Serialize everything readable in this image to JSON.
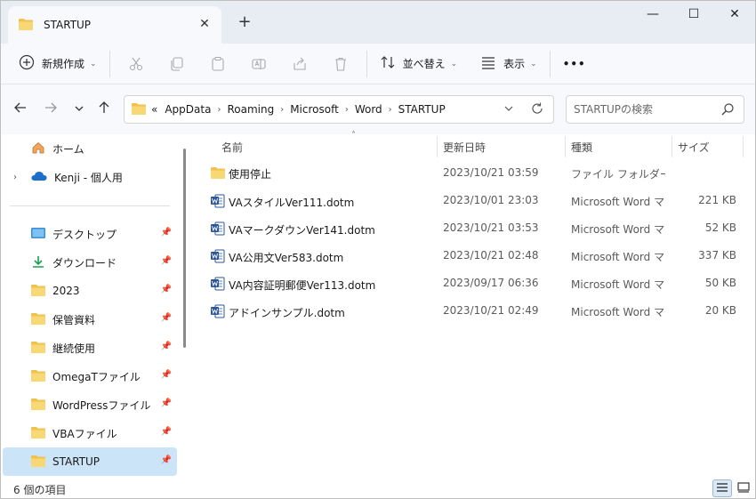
{
  "window": {
    "tab_title": "STARTUP",
    "tab_close": "✕",
    "new_tab": "+",
    "minimize": "—",
    "maximize": "☐",
    "close": "✕"
  },
  "commandbar": {
    "new_label": "新規作成",
    "sort_label": "並べ替え",
    "view_label": "表示",
    "more_label": "•••"
  },
  "address": {
    "overflow": "«",
    "crumbs": [
      "AppData",
      "Roaming",
      "Microsoft",
      "Word",
      "STARTUP"
    ],
    "separator": "›",
    "search_placeholder": "STARTUPの検索"
  },
  "sidebar": {
    "home": "ホーム",
    "cloud": "Kenji - 個人用",
    "items": [
      {
        "label": "デスクトップ",
        "icon": "desktop-icon"
      },
      {
        "label": "ダウンロード",
        "icon": "download-icon"
      },
      {
        "label": "2023",
        "icon": "folder-icon"
      },
      {
        "label": "保管資料",
        "icon": "folder-icon"
      },
      {
        "label": "継続使用",
        "icon": "folder-icon"
      },
      {
        "label": "OmegaTファイル",
        "icon": "folder-icon"
      },
      {
        "label": "WordPressファイル",
        "icon": "folder-icon"
      },
      {
        "label": "VBAファイル",
        "icon": "folder-icon"
      },
      {
        "label": "STARTUP",
        "icon": "folder-icon"
      }
    ]
  },
  "columns": {
    "name": "名前",
    "date": "更新日時",
    "type": "種類",
    "size": "サイズ"
  },
  "files": [
    {
      "name": "使用停止",
      "date": "2023/10/21 03:59",
      "type": "ファイル フォルダー",
      "size": "",
      "kind": "folder"
    },
    {
      "name": "VAスタイルVer111.dotm",
      "date": "2023/10/01 23:03",
      "type": "Microsoft Word マ...",
      "size": "221 KB",
      "kind": "word"
    },
    {
      "name": "VAマークダウンVer141.dotm",
      "date": "2023/10/21 03:53",
      "type": "Microsoft Word マ...",
      "size": "52 KB",
      "kind": "word"
    },
    {
      "name": "VA公用文Ver583.dotm",
      "date": "2023/10/21 02:48",
      "type": "Microsoft Word マ...",
      "size": "337 KB",
      "kind": "word"
    },
    {
      "name": "VA内容証明郵便Ver113.dotm",
      "date": "2023/09/17 06:36",
      "type": "Microsoft Word マ...",
      "size": "50 KB",
      "kind": "word"
    },
    {
      "name": "アドインサンプル.dotm",
      "date": "2023/10/21 02:49",
      "type": "Microsoft Word マ...",
      "size": "20 KB",
      "kind": "word"
    }
  ],
  "status": {
    "item_count": "6 個の項目"
  },
  "colors": {
    "folder": "#f2c14e",
    "word": "#2b579a",
    "selected": "#cce4f7",
    "accent": "#0067c0"
  }
}
